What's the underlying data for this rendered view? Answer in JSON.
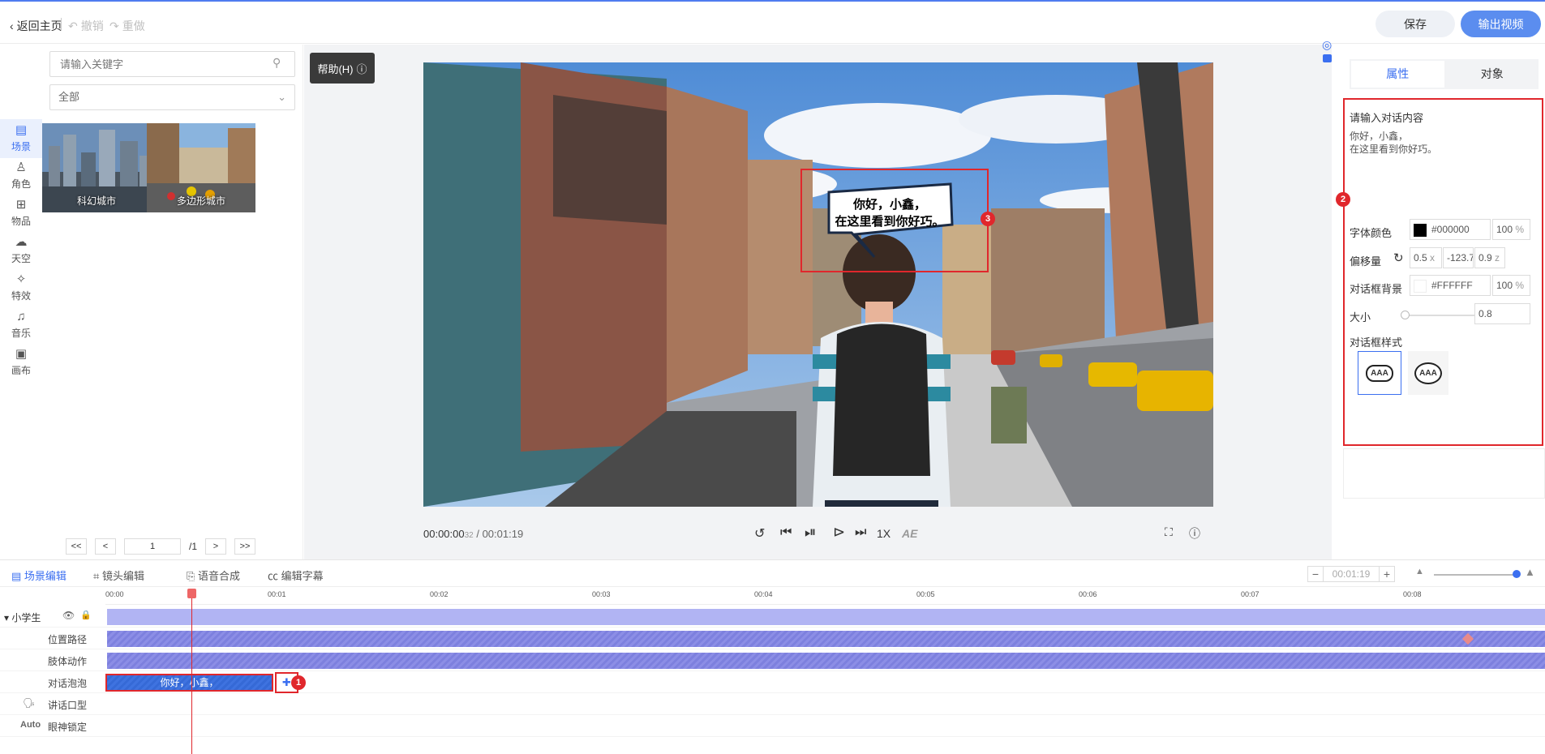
{
  "topbar": {
    "back_label": "返回主页",
    "undo_label": "撤销",
    "redo_label": "重做",
    "save_label": "保存",
    "export_label": "输出视频"
  },
  "leftnav": {
    "items": [
      {
        "label": "场景",
        "icon": "scene-icon"
      },
      {
        "label": "角色",
        "icon": "character-icon"
      },
      {
        "label": "物品",
        "icon": "objects-icon"
      },
      {
        "label": "天空",
        "icon": "sky-icon"
      },
      {
        "label": "特效",
        "icon": "effects-icon"
      },
      {
        "label": "音乐",
        "icon": "music-icon"
      },
      {
        "label": "画布",
        "icon": "canvas-icon"
      }
    ]
  },
  "library": {
    "search_placeholder": "请输入关键字",
    "filter_value": "全部",
    "items": [
      {
        "label": "科幻城市"
      },
      {
        "label": "多边形城市"
      }
    ],
    "pager": {
      "first": "<<",
      "prev": "<",
      "page": "1",
      "total": "/1",
      "next": ">",
      "last": ">>"
    }
  },
  "stage": {
    "help_label": "帮助(H)",
    "bubble_line1": "你好，小鑫，",
    "bubble_line2": "在这里看到你好巧。",
    "timecode_current": "00:00:00",
    "timecode_ms": "32",
    "timecode_sep": " / ",
    "timecode_total": "00:01:19",
    "speed_label": "1X",
    "ae_label": "AE"
  },
  "rightpanel": {
    "tab_properties": "属性",
    "tab_object": "对象",
    "dialog_content_label": "请输入对话内容",
    "dialog_text": "你好，小鑫，\n在这里看到你好巧。",
    "font_color_label": "字体颜色",
    "font_color_value": "#000000",
    "font_color_opacity": "100",
    "percent": "%",
    "offset_label": "偏移量",
    "offset_x": "0.5",
    "offset_x_axis": "x",
    "offset_y": "-123.7",
    "offset_y_axis": "y",
    "offset_z": "0.9",
    "offset_z_axis": "z",
    "bg_label": "对话框背景",
    "bg_value": "#FFFFFF",
    "bg_opacity": "100",
    "size_label": "大小",
    "size_value": "0.8",
    "style_label": "对话框样式",
    "style_sample": "AAA",
    "colors": {
      "font": "#000000",
      "bg": "#FFFFFF",
      "accent": "#3b6ff0",
      "highlight": "#e0272c"
    }
  },
  "badges": {
    "one": "1",
    "two": "2",
    "three": "3"
  },
  "timeline": {
    "tabs": [
      "场景编辑",
      "镜头编辑",
      "语音合成",
      "编辑字幕"
    ],
    "duration": "00:01:19",
    "minus": "−",
    "plus": "+",
    "ticks": [
      "00:00",
      "00:01",
      "00:02",
      "00:03",
      "00:04",
      "00:05",
      "00:06",
      "00:07",
      "00:08"
    ],
    "character": "小学生",
    "rows": [
      "位置路径",
      "肢体动作",
      "对话泡泡",
      "讲话口型",
      "眼神锁定"
    ],
    "auto_label": "Auto",
    "clip_text": "你好，小鑫，"
  }
}
